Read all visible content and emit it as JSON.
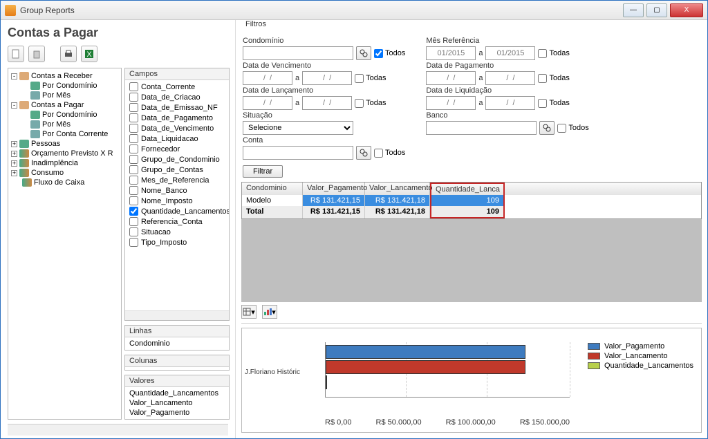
{
  "window": {
    "title": "Group Reports",
    "btn_min": "—",
    "btn_max": "▢",
    "btn_close": "X"
  },
  "page": {
    "title": "Contas a Pagar"
  },
  "tree": [
    {
      "exp": "-",
      "label": "Contas a Receber",
      "cls": "orange"
    },
    {
      "child": true,
      "label": "Por Condomínio",
      "cls": "green"
    },
    {
      "child": true,
      "label": "Por Mês",
      "cls": "blue"
    },
    {
      "exp": "-",
      "label": "Contas a Pagar",
      "cls": "orange"
    },
    {
      "child": true,
      "label": "Por Condomínio",
      "cls": "green"
    },
    {
      "child": true,
      "label": "Por Mês",
      "cls": "blue"
    },
    {
      "child": true,
      "label": "Por Conta Corrente",
      "cls": "blue"
    },
    {
      "exp": "+",
      "label": "Pessoas",
      "cls": "green"
    },
    {
      "exp": "+",
      "label": "Orçamento Previsto X R",
      "cls": "chart"
    },
    {
      "exp": "+",
      "label": "Inadimplência",
      "cls": "chart"
    },
    {
      "exp": "+",
      "label": "Consumo",
      "cls": "chart"
    },
    {
      "exp": "",
      "label": "Fluxo de Caixa",
      "cls": "chart",
      "child2": true
    }
  ],
  "panes": {
    "campos": {
      "title": "Campos",
      "items": [
        {
          "label": "Conta_Corrente",
          "chk": false
        },
        {
          "label": "Data_de_Criacao",
          "chk": false
        },
        {
          "label": "Data_de_Emissao_NF",
          "chk": false
        },
        {
          "label": "Data_de_Pagamento",
          "chk": false
        },
        {
          "label": "Data_de_Vencimento",
          "chk": false
        },
        {
          "label": "Data_Liquidacao",
          "chk": false
        },
        {
          "label": "Fornecedor",
          "chk": false
        },
        {
          "label": "Grupo_de_Condominio",
          "chk": false
        },
        {
          "label": "Grupo_de_Contas",
          "chk": false
        },
        {
          "label": "Mes_de_Referencia",
          "chk": false
        },
        {
          "label": "Nome_Banco",
          "chk": false
        },
        {
          "label": "Nome_Imposto",
          "chk": false
        },
        {
          "label": "Quantidade_Lancamentos",
          "chk": true
        },
        {
          "label": "Referencia_Conta",
          "chk": false
        },
        {
          "label": "Situacao",
          "chk": false
        },
        {
          "label": "Tipo_Imposto",
          "chk": false
        }
      ]
    },
    "linhas": {
      "title": "Linhas",
      "items": [
        "Condominio"
      ]
    },
    "colunas": {
      "title": "Colunas",
      "items": []
    },
    "valores": {
      "title": "Valores",
      "items": [
        "Quantidade_Lancamentos",
        "Valor_Lancamento",
        "Valor_Pagamento"
      ]
    }
  },
  "filters": {
    "section": "Filtros",
    "condominio": {
      "label": "Condomínio",
      "todos": "Todos",
      "todos_checked": true
    },
    "data_venc": {
      "label": "Data de Vencimento",
      "a": "a",
      "ph": "/  /",
      "todas": "Todas"
    },
    "data_lanc": {
      "label": "Data de Lançamento",
      "a": "a",
      "ph": "/  /",
      "todas": "Todas"
    },
    "situacao": {
      "label": "Situação",
      "value": "Selecione"
    },
    "conta": {
      "label": "Conta",
      "todos": "Todos"
    },
    "filtrar": "Filtrar",
    "mes_ref": {
      "label": "Mês Referência",
      "from": "01/2015",
      "a": "a",
      "to": "01/2015",
      "todas": "Todas"
    },
    "data_pag": {
      "label": "Data de Pagamento",
      "a": "a",
      "ph": "/  /",
      "todas": "Todas"
    },
    "data_liq": {
      "label": "Data de Liquidação",
      "a": "a",
      "ph": "/  /",
      "todas": "Todas"
    },
    "banco": {
      "label": "Banco",
      "todos": "Todos"
    }
  },
  "grid": {
    "headers": [
      "Condominio",
      "Valor_Pagamento",
      "Valor_Lancamento",
      "Quantidade_Lanca"
    ],
    "row": {
      "name": "Modelo",
      "vp": "R$ 131.421,15",
      "vl": "R$ 131.421,18",
      "ql": "109"
    },
    "total": {
      "name": "Total",
      "vp": "R$ 131.421,15",
      "vl": "R$ 131.421,18",
      "ql": "109"
    }
  },
  "chart_data": {
    "type": "bar",
    "orientation": "horizontal",
    "categories": [
      "J.Floriano Históric"
    ],
    "series": [
      {
        "name": "Valor_Pagamento",
        "values": [
          131421.15
        ],
        "color": "#3e7bbf"
      },
      {
        "name": "Valor_Lancamento",
        "values": [
          131421.18
        ],
        "color": "#c0392b"
      },
      {
        "name": "Quantidade_Lancamentos",
        "values": [
          109
        ],
        "color": "#b7cf4b"
      }
    ],
    "x_ticks": [
      "R$ 0,00",
      "R$ 50.000,00",
      "R$ 100.000,00",
      "R$ 150.000,00"
    ],
    "xlim": [
      0,
      150000
    ]
  }
}
